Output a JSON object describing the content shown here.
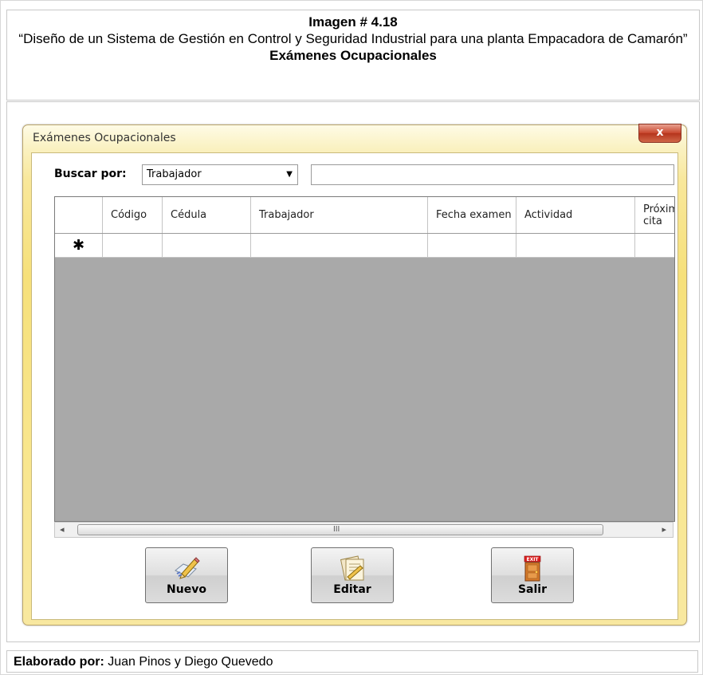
{
  "caption": {
    "title": "Imagen # 4.18",
    "description": "“Diseño de un Sistema de Gestión en Control y Seguridad Industrial para una planta Empacadora de Camarón”",
    "subtitle": "Exámenes Ocupacionales"
  },
  "window": {
    "title": "Exámenes Ocupacionales",
    "close_glyph": "x"
  },
  "search": {
    "label": "Buscar por:",
    "selected": "Trabajador",
    "input_value": ""
  },
  "grid": {
    "columns": [
      "Código",
      "Cédula",
      "Trabajador",
      "Fecha examen",
      "Actividad",
      "Próxima cita"
    ],
    "new_row_marker": "✱",
    "rows": []
  },
  "scrollbar": {
    "left_arrow": "◂",
    "right_arrow": "▸",
    "grip": "III"
  },
  "buttons": {
    "nuevo": "Nuevo",
    "editar": "Editar",
    "salir": "Salir",
    "exit_sign": "EXIT"
  },
  "footer": {
    "label": "Elaborado por:",
    "authors": " Juan Pinos y Diego Quevedo"
  }
}
